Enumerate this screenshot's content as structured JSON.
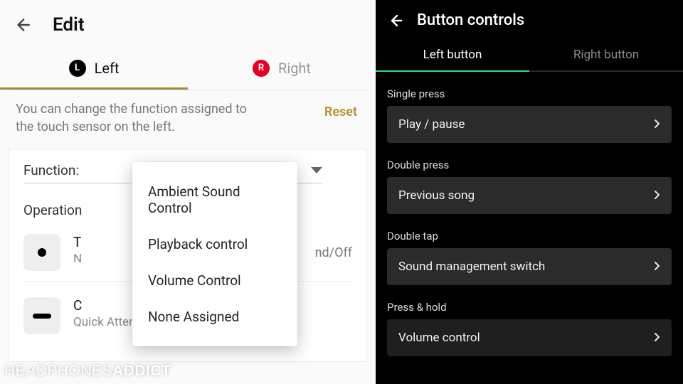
{
  "left": {
    "title": "Edit",
    "tabs": {
      "left": "Left",
      "right": "Right",
      "leftBadge": "L",
      "rightBadge": "R"
    },
    "note": "You can change the function assigned to the touch sensor on the left.",
    "reset": "Reset",
    "functionLabel": "Function:",
    "operationsLabel": "Operation",
    "op1": {
      "title": "T",
      "hint": "nd/Off"
    },
    "op2": {
      "title": "C",
      "sub": "Quick Attention"
    },
    "dropdown": [
      "Ambient Sound Control",
      "Playback control",
      "Volume Control",
      "None Assigned"
    ]
  },
  "right": {
    "title": "Button controls",
    "tabs": {
      "left": "Left button",
      "right": "Right button"
    },
    "sections": {
      "single": {
        "label": "Single press",
        "value": "Play / pause"
      },
      "double": {
        "label": "Double press",
        "value": "Previous song"
      },
      "tap": {
        "label": "Double tap",
        "value": "Sound management switch"
      },
      "hold": {
        "label": "Press & hold",
        "value": "Volume control"
      }
    }
  },
  "watermark": {
    "a": "HEADPHONES",
    "b": "ADDICT"
  }
}
